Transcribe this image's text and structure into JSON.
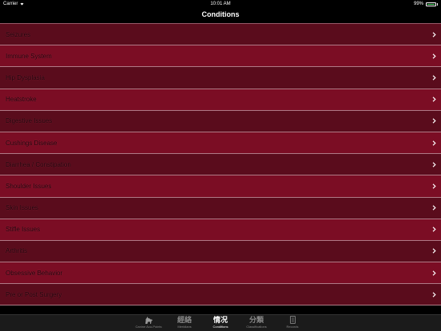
{
  "status": {
    "carrier": "Carrier",
    "time": "10:01 AM",
    "battery": "99%",
    "battery_level": 0.99
  },
  "nav": {
    "title": "Conditions"
  },
  "conditions": [
    "Seizures",
    "Immune System",
    "Hip Dysplasia",
    "Heatstroke",
    "Digestive Issues",
    "Cushings Disease",
    "Diarrhea / Constipation",
    "Shoulder Issues",
    "Skin Issues",
    "Stifle Issues",
    "Arthritis",
    "Obsessive Behavior",
    "Pre or Post Surgery"
  ],
  "tabs": [
    {
      "icon": "dog-icon",
      "glyph": "",
      "label": "Canine Acu-Points",
      "active": false
    },
    {
      "icon": "meridians-icon",
      "glyph": "經絡",
      "label": "Meridians",
      "active": false
    },
    {
      "icon": "conditions-icon",
      "glyph": "情况",
      "label": "Conditions",
      "active": true
    },
    {
      "icon": "classifications-icon",
      "glyph": "分類",
      "label": "Classifications",
      "active": false
    },
    {
      "icon": "book-icon",
      "glyph": "",
      "label": "Records",
      "active": false
    }
  ],
  "colors": {
    "row_dark": "#5a0c1c",
    "row_light": "#7b0d24",
    "tab_active": "#ffffff",
    "tab_inactive": "#8a8a8a"
  }
}
